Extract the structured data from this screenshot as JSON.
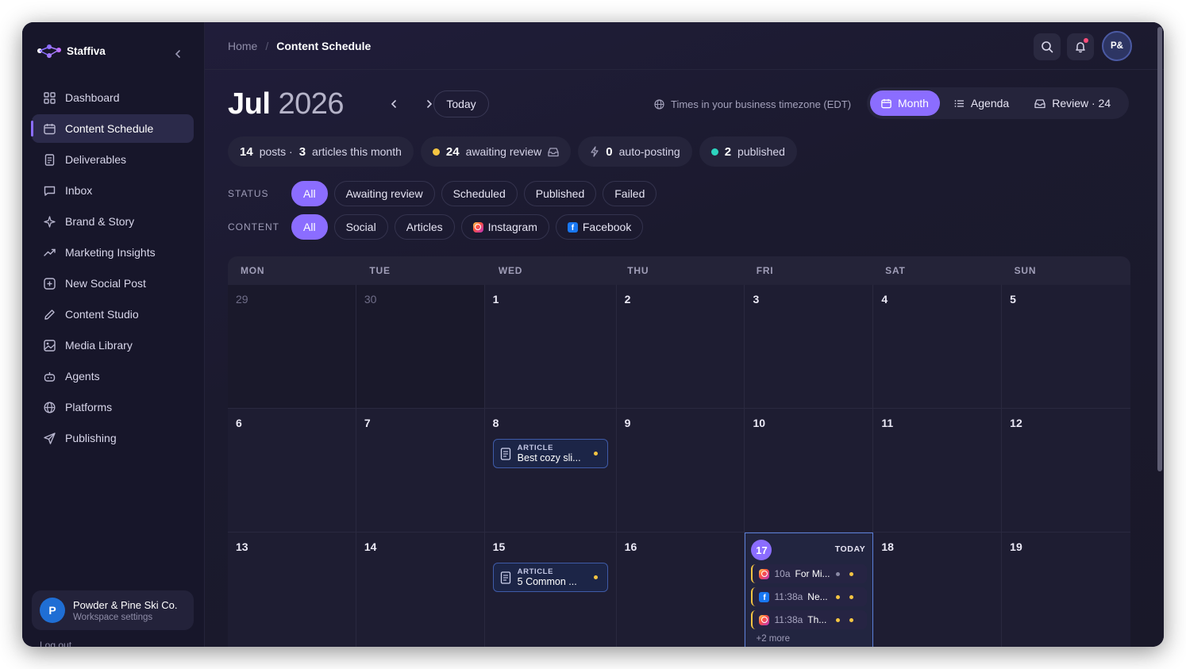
{
  "app": {
    "name": "Staffiva"
  },
  "sidebar": {
    "items": [
      {
        "label": "Dashboard",
        "icon": "grid-icon"
      },
      {
        "label": "Content Schedule",
        "icon": "calendar-icon",
        "active": true
      },
      {
        "label": "Deliverables",
        "icon": "document-icon"
      },
      {
        "label": "Inbox",
        "icon": "message-icon"
      },
      {
        "label": "Brand & Story",
        "icon": "sparkle-icon"
      },
      {
        "label": "Marketing Insights",
        "icon": "trend-icon"
      },
      {
        "label": "New Social Post",
        "icon": "plus-square-icon"
      },
      {
        "label": "Content Studio",
        "icon": "pencil-icon"
      },
      {
        "label": "Media Library",
        "icon": "image-icon"
      },
      {
        "label": "Agents",
        "icon": "bot-icon"
      },
      {
        "label": "Platforms",
        "icon": "globe-icon"
      },
      {
        "label": "Publishing",
        "icon": "send-icon"
      }
    ],
    "workspace": {
      "initial": "P",
      "name": "Powder & Pine Ski Co.",
      "subtitle": "Workspace settings"
    },
    "logout": "Log out"
  },
  "header": {
    "breadcrumb": {
      "home": "Home",
      "separator": "/",
      "current": "Content Schedule"
    },
    "user_initials": "P&"
  },
  "calendar_header": {
    "month": "Jul",
    "year": "2026",
    "today_label": "Today",
    "timezone_note": "Times in your business timezone (EDT)",
    "views": {
      "month": "Month",
      "agenda": "Agenda",
      "review": "Review · 24"
    }
  },
  "stats": {
    "posts_count": "14",
    "posts_label": "posts ·",
    "articles_count": "3",
    "articles_label": "articles this month",
    "awaiting_count": "24",
    "awaiting_label": "awaiting review",
    "autopost_count": "0",
    "autopost_label": "auto-posting",
    "published_count": "2",
    "published_label": "published"
  },
  "filters": {
    "status_label": "STATUS",
    "status": [
      "All",
      "Awaiting review",
      "Scheduled",
      "Published",
      "Failed"
    ],
    "content_label": "CONTENT",
    "content": [
      "All",
      "Social",
      "Articles",
      "Instagram",
      "Facebook"
    ]
  },
  "calendar": {
    "weekdays": [
      "MON",
      "TUE",
      "WED",
      "THU",
      "FRI",
      "SAT",
      "SUN"
    ],
    "week1": [
      "29",
      "30",
      "1",
      "2",
      "3",
      "4",
      "5"
    ],
    "week2": [
      "6",
      "7",
      "8",
      "9",
      "10",
      "11",
      "12"
    ],
    "week3": [
      "13",
      "14",
      "15",
      "16",
      "17",
      "18",
      "19"
    ],
    "event_jul8": {
      "kind": "ARTICLE",
      "title": "Best cozy sli..."
    },
    "event_jul15": {
      "kind": "ARTICLE",
      "title": "5 Common ..."
    },
    "today": {
      "tag": "TODAY",
      "posts": [
        {
          "platform": "instagram",
          "time": "10a",
          "title": "For Mi..."
        },
        {
          "platform": "facebook",
          "time": "11:38a",
          "title": "Ne..."
        },
        {
          "platform": "instagram",
          "time": "11:38a",
          "title": "Th..."
        }
      ],
      "more": "+2 more"
    }
  },
  "colors": {
    "accent": "#8b6dff",
    "awaiting": "#f5c542",
    "published": "#2dd4bf"
  }
}
